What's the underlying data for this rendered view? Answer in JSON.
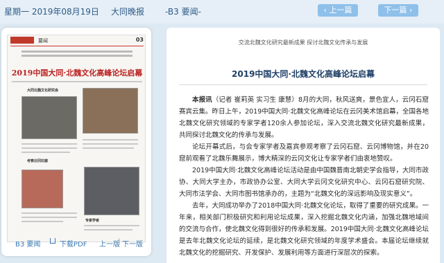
{
  "header": {
    "date": "星期一 2019年08月19日",
    "paper": "大同晚报",
    "page": "-B3 要闻-",
    "prev_page": "上一篇",
    "next_page": "下一篇"
  },
  "thumbnail": {
    "section": "要闻",
    "page_num": "03",
    "title": "2019中国大同·北魏文化高峰论坛启幕",
    "captions": [
      "大同北魏文化研究会",
      "考察云冈石窟",
      "专家学者"
    ],
    "footer": {
      "page_label": "B3 要闻",
      "download": "下载PDF",
      "prev_page": "上一版",
      "next_page": "下一版",
      "separator": "|"
    }
  },
  "article": {
    "subtitle": "交流北魏文化研究最新成果 探讨北魏文化传承与发展",
    "title": "2019中国大同·北魏文化高峰论坛启幕",
    "lead_label": "本报讯",
    "reporter": "（记者 崔莉英 实习生 康慧）",
    "p1": "8月的大同，秋风送爽，景色宜人，云冈石窟赛宾云集。昨日上午，2019中国大同·北魏文化高峰论坛在云冈美术馆启幕，全国各地北魏文化研究领域的专家学者120余人参加论坛，深入交流北魏文化研究最新成果，共同探讨北魏文化的传承与发展。",
    "p2": "论坛开幕式后，与会专家学者及嘉宾参观考察了云冈石窟、云冈博物馆，并在20窟前观看了北魏乐舞展示，博大精深的云冈文化让专家学者们由衷地赞叹。",
    "p3": "2019中国大同·北魏文化高峰论坛活动是由中国魏晋南北朝史学会指导，大同市政协、大同大学主办，市政协办公室、大同大学云冈文化研究中心、云冈石窟研究院、大同市法学会、大同市图书馆承办的，主题为“北魏文化的深远影响及现实意义”。",
    "p4": "去年，大同成功举办了2018中国大同·北魏文化论坛，取得了重要的研究成果。一年来，相关部门积极研究和利用论坛成果，深入挖掘北魏文化内涵，加强北魏地域间的交流与合作，使北魏文化得到很好的传承和发展。2019中国大同·北魏文化高峰论坛是去年北魏文化论坛的延续，是北魏文化研究领域的年度学术盛会。本届论坛继续就北魏文化的挖掘研究、开发保护、发展利用等方面进行深层次的探索。"
  },
  "colors": {
    "accent": "#8ec0ea",
    "title": "#1e3f66",
    "link": "#3a78b5",
    "background": "#dde9f3"
  }
}
